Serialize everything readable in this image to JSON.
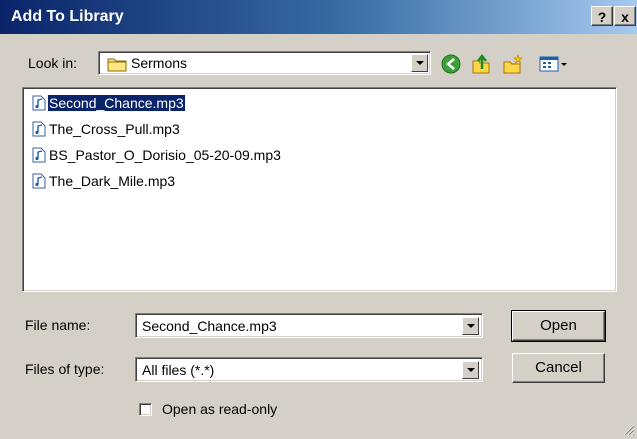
{
  "window": {
    "title": "Add To Library",
    "help_label": "?",
    "close_label": "x"
  },
  "lookin": {
    "label": "Look in:",
    "value": "Sermons"
  },
  "toolbar": {
    "icons": [
      "back-icon",
      "up-folder-icon",
      "new-folder-icon",
      "view-menu-icon"
    ]
  },
  "files": [
    {
      "name": "Second_Chance.mp3",
      "selected": true
    },
    {
      "name": "The_Cross_Pull.mp3",
      "selected": false
    },
    {
      "name": "BS_Pastor_O_Dorisio_05-20-09.mp3",
      "selected": false
    },
    {
      "name": "The_Dark_Mile.mp3",
      "selected": false
    }
  ],
  "filename": {
    "label": "File name:",
    "value": "Second_Chance.mp3"
  },
  "filetype": {
    "label": "Files of type:",
    "value": "All files (*.*)"
  },
  "buttons": {
    "open": "Open",
    "cancel": "Cancel"
  },
  "readonly": {
    "label": "Open as read-only",
    "checked": false
  },
  "colors": {
    "title_start": "#0a246a",
    "selection": "#0a246a",
    "face": "#d4d0c8"
  }
}
